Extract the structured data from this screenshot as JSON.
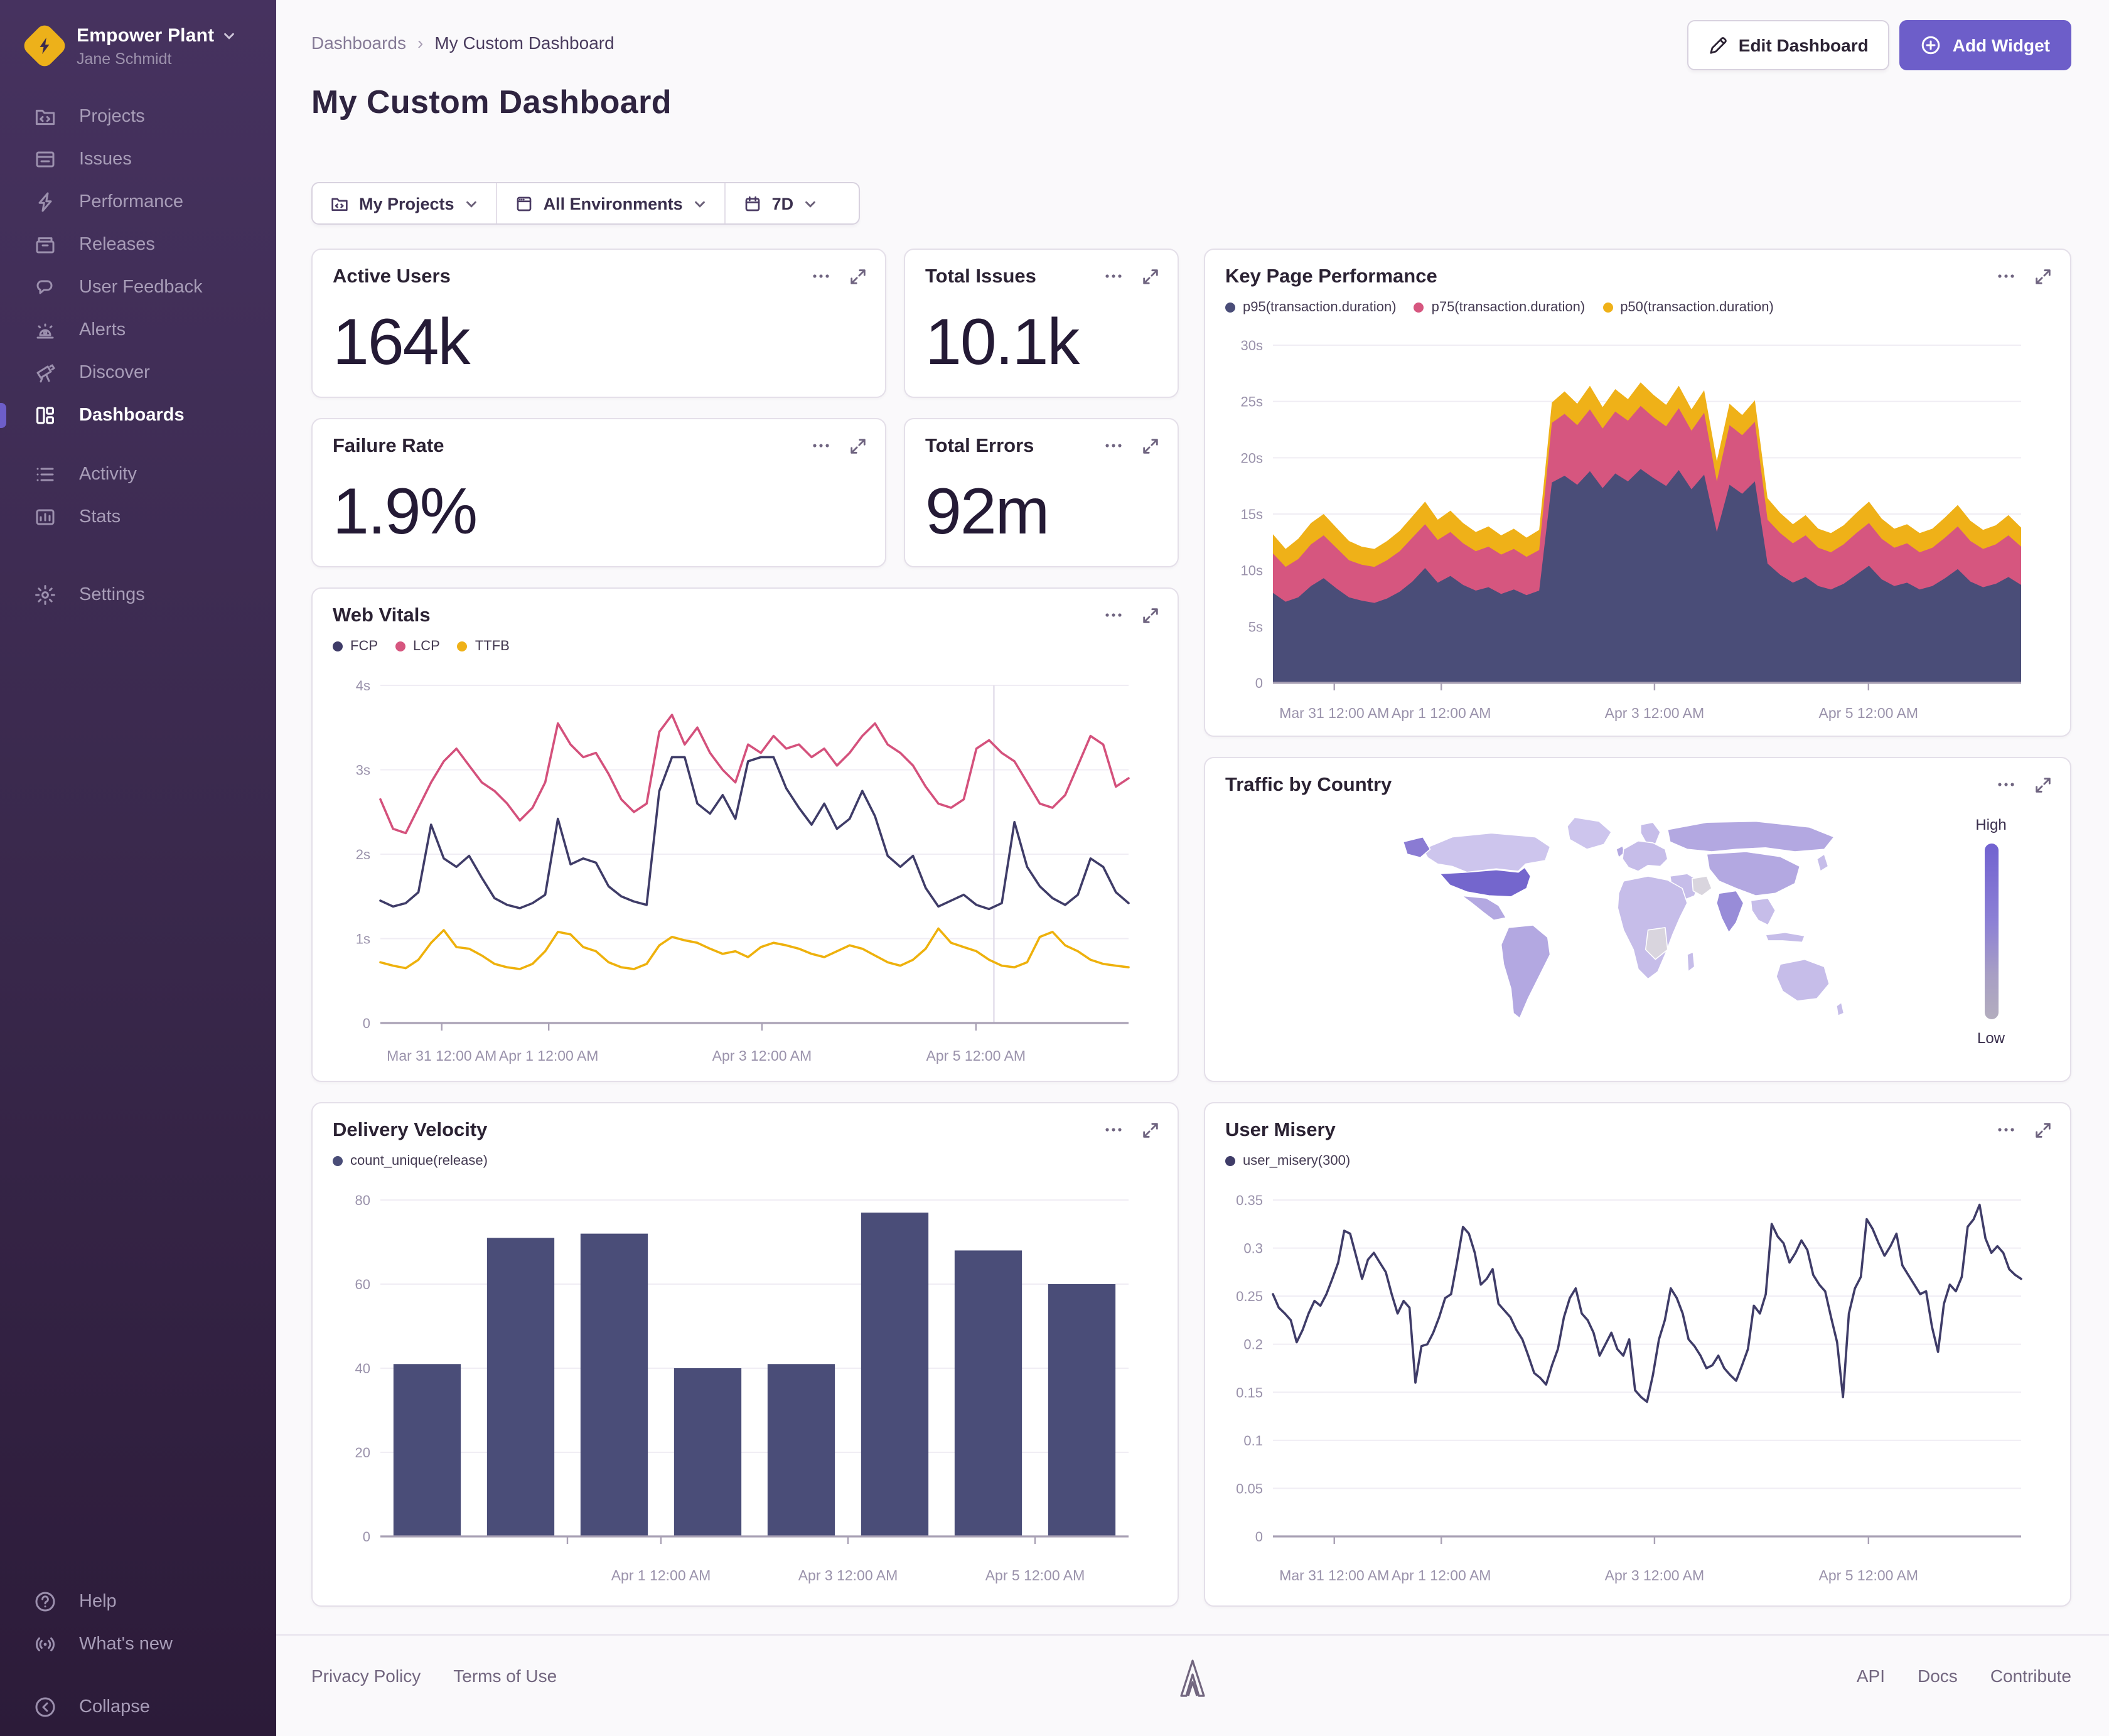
{
  "sidebar": {
    "org": "Empower Plant",
    "user": "Jane Schmidt",
    "items": [
      {
        "label": "Projects",
        "icon": "projects-icon",
        "active": false
      },
      {
        "label": "Issues",
        "icon": "issues-icon",
        "active": false
      },
      {
        "label": "Performance",
        "icon": "performance-icon",
        "active": false
      },
      {
        "label": "Releases",
        "icon": "releases-icon",
        "active": false
      },
      {
        "label": "User Feedback",
        "icon": "user-feedback-icon",
        "active": false
      },
      {
        "label": "Alerts",
        "icon": "alerts-icon",
        "active": false
      },
      {
        "label": "Discover",
        "icon": "discover-icon",
        "active": false
      },
      {
        "label": "Dashboards",
        "icon": "dashboards-icon",
        "active": true
      },
      {
        "label": "Activity",
        "icon": "activity-icon",
        "active": false
      },
      {
        "label": "Stats",
        "icon": "stats-icon",
        "active": false
      },
      {
        "label": "Settings",
        "icon": "settings-icon",
        "active": false
      }
    ],
    "bottom_items": [
      {
        "label": "Help",
        "icon": "help-icon"
      },
      {
        "label": "What's new",
        "icon": "broadcast-icon"
      },
      {
        "label": "Collapse",
        "icon": "collapse-icon"
      }
    ]
  },
  "header": {
    "breadcrumb": [
      "Dashboards",
      "My Custom Dashboard"
    ],
    "title": "My Custom Dashboard",
    "edit_label": "Edit Dashboard",
    "add_label": "Add Widget"
  },
  "filters": {
    "projects": "My Projects",
    "environments": "All Environments",
    "range": "7D"
  },
  "big_numbers": [
    {
      "title": "Active Users",
      "value": "164k"
    },
    {
      "title": "Total Issues",
      "value": "10.1k"
    },
    {
      "title": "Failure Rate",
      "value": "1.9%"
    },
    {
      "title": "Total Errors",
      "value": "92m"
    }
  ],
  "map_widget": {
    "title": "Traffic by Country",
    "legend_high": "High",
    "legend_low": "Low"
  },
  "footer": {
    "left": [
      "Privacy Policy",
      "Terms of Use"
    ],
    "right": [
      "API",
      "Docs",
      "Contribute"
    ]
  },
  "colors": {
    "accent": "#6d5ec9",
    "navy": "#4a4d78",
    "pink": "#d6567f",
    "yellow": "#efb118",
    "map_base": "#c6bde9",
    "map_light": "#cdc5ed",
    "map_mid": "#b3a8e1",
    "map_dark_us": "#7466cd",
    "map_alaska": "#8a7bd3",
    "map_india": "#988cd8",
    "map_gray": "#d9d5de"
  },
  "chart_data": [
    {
      "id": "key-page-performance",
      "type": "area",
      "title": "Key Page Performance",
      "note": "stacked totals drawn as overlapping areas (p50 top band, p75 middle, p95 base)",
      "legend": [
        {
          "label": "p95(transaction.duration)",
          "color": "#4a4d78"
        },
        {
          "label": "p75(transaction.duration)",
          "color": "#d6567f"
        },
        {
          "label": "p50(transaction.duration)",
          "color": "#efb118"
        }
      ],
      "ylim": [
        0,
        30
      ],
      "yticks": [
        {
          "v": 0,
          "label": "0"
        },
        {
          "v": 5,
          "label": "5s"
        },
        {
          "v": 10,
          "label": "10s"
        },
        {
          "v": 15,
          "label": "15s"
        },
        {
          "v": 20,
          "label": "20s"
        },
        {
          "v": 25,
          "label": "25s"
        },
        {
          "v": 30,
          "label": "30s"
        }
      ],
      "xticks": [
        {
          "pos": 0.082,
          "label": "Mar 31 12:00 AM"
        },
        {
          "pos": 0.225,
          "label": "Apr 1 12:00 AM"
        },
        {
          "pos": 0.51,
          "label": "Apr 3 12:00 AM"
        },
        {
          "pos": 0.796,
          "label": "Apr 5 12:00 AM"
        }
      ],
      "series": [
        {
          "name": "p50_total",
          "color": "#efb118",
          "fill": true,
          "values": [
            13.2,
            11.9,
            12.8,
            14.2,
            15.0,
            13.8,
            12.6,
            12.1,
            11.9,
            12.6,
            13.5,
            14.8,
            16.1,
            14.5,
            15.3,
            14.2,
            13.4,
            13.9,
            13.1,
            13.7,
            12.9,
            13.6,
            24.9,
            25.9,
            24.8,
            26.4,
            24.5,
            26.1,
            25.2,
            26.7,
            25.6,
            24.7,
            26.4,
            24.3,
            26.0,
            19.7,
            24.8,
            23.8,
            25.1,
            16.4,
            15.1,
            14.1,
            14.9,
            13.7,
            13.3,
            14.0,
            15.1,
            16.1,
            14.6,
            13.7,
            14.1,
            13.3,
            13.7,
            14.7,
            15.8,
            14.4,
            13.6,
            14.0,
            14.9,
            13.8
          ]
        },
        {
          "name": "p75_total",
          "color": "#d6567f",
          "fill": true,
          "values": [
            11.5,
            10.3,
            11.0,
            12.3,
            13.1,
            12.0,
            10.9,
            10.5,
            10.3,
            10.9,
            11.7,
            12.9,
            14.1,
            12.7,
            13.4,
            12.4,
            11.7,
            12.1,
            11.4,
            11.9,
            11.2,
            11.8,
            23.1,
            23.9,
            22.9,
            24.3,
            22.6,
            24.1,
            23.3,
            24.6,
            23.6,
            22.8,
            24.4,
            22.4,
            24.0,
            17.9,
            22.9,
            22.0,
            23.2,
            14.5,
            13.3,
            12.4,
            13.1,
            12.0,
            11.6,
            12.3,
            13.3,
            14.2,
            12.8,
            12.0,
            12.4,
            11.6,
            12.0,
            12.9,
            13.9,
            12.6,
            11.9,
            12.3,
            13.1,
            12.1
          ]
        },
        {
          "name": "p95",
          "color": "#4a4d78",
          "fill": true,
          "values": [
            8.0,
            7.2,
            7.6,
            8.6,
            9.3,
            8.4,
            7.6,
            7.3,
            7.1,
            7.5,
            8.1,
            9.0,
            10.2,
            8.9,
            9.5,
            8.7,
            8.2,
            8.5,
            7.9,
            8.3,
            7.8,
            8.2,
            17.8,
            18.4,
            17.6,
            18.8,
            17.3,
            18.6,
            17.9,
            19.0,
            18.2,
            17.5,
            18.9,
            17.2,
            18.5,
            13.4,
            17.6,
            16.8,
            17.9,
            10.6,
            9.6,
            8.9,
            9.4,
            8.6,
            8.3,
            8.8,
            9.6,
            10.4,
            9.2,
            8.6,
            8.9,
            8.3,
            8.6,
            9.3,
            10.1,
            9.0,
            8.5,
            8.8,
            9.4,
            8.7
          ]
        }
      ]
    },
    {
      "id": "web-vitals",
      "type": "line",
      "title": "Web Vitals",
      "legend": [
        {
          "label": "FCP",
          "color": "#3f3c68"
        },
        {
          "label": "LCP",
          "color": "#d6567f"
        },
        {
          "label": "TTFB",
          "color": "#efb118"
        }
      ],
      "ylim": [
        0,
        4
      ],
      "yticks": [
        {
          "v": 0,
          "label": "0"
        },
        {
          "v": 1,
          "label": "1s"
        },
        {
          "v": 2,
          "label": "2s"
        },
        {
          "v": 3,
          "label": "3s"
        },
        {
          "v": 4,
          "label": "4s"
        }
      ],
      "xticks": [
        {
          "pos": 0.082,
          "label": "Mar 31 12:00 AM"
        },
        {
          "pos": 0.225,
          "label": "Apr 1 12:00 AM"
        },
        {
          "pos": 0.51,
          "label": "Apr 3 12:00 AM"
        },
        {
          "pos": 0.796,
          "label": "Apr 5 12:00 AM"
        }
      ],
      "crosshair": 0.82,
      "series": [
        {
          "name": "LCP",
          "color": "#d4517c",
          "values": [
            2.65,
            2.3,
            2.25,
            2.55,
            2.85,
            3.1,
            3.25,
            3.05,
            2.85,
            2.75,
            2.6,
            2.4,
            2.55,
            2.85,
            3.55,
            3.3,
            3.15,
            3.2,
            2.95,
            2.65,
            2.5,
            2.6,
            3.45,
            3.65,
            3.3,
            3.5,
            3.2,
            3.0,
            2.85,
            3.3,
            3.2,
            3.4,
            3.25,
            3.3,
            3.15,
            3.25,
            3.05,
            3.2,
            3.4,
            3.55,
            3.3,
            3.2,
            3.05,
            2.8,
            2.6,
            2.55,
            2.65,
            3.25,
            3.35,
            3.2,
            3.1,
            2.85,
            2.6,
            2.55,
            2.7,
            3.05,
            3.4,
            3.3,
            2.8,
            2.9
          ]
        },
        {
          "name": "TTFB",
          "color": "#eeb10c",
          "values": [
            0.72,
            0.68,
            0.65,
            0.75,
            0.95,
            1.1,
            0.9,
            0.88,
            0.8,
            0.7,
            0.66,
            0.64,
            0.7,
            0.85,
            1.08,
            1.05,
            0.9,
            0.85,
            0.72,
            0.66,
            0.64,
            0.7,
            0.92,
            1.02,
            0.98,
            0.95,
            0.88,
            0.82,
            0.85,
            0.78,
            0.9,
            0.95,
            0.92,
            0.88,
            0.82,
            0.78,
            0.85,
            0.92,
            0.88,
            0.8,
            0.72,
            0.68,
            0.75,
            0.88,
            1.12,
            0.95,
            0.9,
            0.85,
            0.75,
            0.68,
            0.66,
            0.72,
            1.02,
            1.08,
            0.92,
            0.85,
            0.75,
            0.7,
            0.68,
            0.66
          ]
        },
        {
          "name": "FCP",
          "color": "#3f3c68",
          "values": [
            1.45,
            1.38,
            1.42,
            1.55,
            2.35,
            1.95,
            1.85,
            1.98,
            1.72,
            1.48,
            1.4,
            1.36,
            1.42,
            1.52,
            2.42,
            1.88,
            1.95,
            1.9,
            1.62,
            1.5,
            1.44,
            1.4,
            2.75,
            3.15,
            3.15,
            2.6,
            2.48,
            2.7,
            2.42,
            3.1,
            3.15,
            3.15,
            2.78,
            2.55,
            2.35,
            2.6,
            2.3,
            2.42,
            2.75,
            2.45,
            1.98,
            1.85,
            1.98,
            1.6,
            1.38,
            1.45,
            1.52,
            1.4,
            1.35,
            1.42,
            2.38,
            1.85,
            1.62,
            1.48,
            1.4,
            1.52,
            1.95,
            1.85,
            1.55,
            1.42
          ]
        }
      ]
    },
    {
      "id": "delivery-velocity",
      "type": "bar",
      "title": "Delivery Velocity",
      "legend": [
        {
          "label": "count_unique(release)",
          "color": "#4a4d78"
        }
      ],
      "ylim": [
        0,
        80
      ],
      "yticks": [
        {
          "v": 0,
          "label": "0"
        },
        {
          "v": 20,
          "label": "20"
        },
        {
          "v": 40,
          "label": "40"
        },
        {
          "v": 60,
          "label": "60"
        },
        {
          "v": 80,
          "label": "80"
        }
      ],
      "xticks": [
        {
          "pos": 0.25,
          "label": ""
        },
        {
          "pos": 0.375,
          "label": "Apr 1 12:00 AM"
        },
        {
          "pos": 0.625,
          "label": "Apr 3 12:00 AM"
        },
        {
          "pos": 0.875,
          "label": "Apr 5 12:00 AM"
        }
      ],
      "bar_color": "#4a4d78",
      "values": [
        41,
        71,
        72,
        40,
        41,
        77,
        68,
        60
      ]
    },
    {
      "id": "user-misery",
      "type": "line",
      "title": "User Misery",
      "legend": [
        {
          "label": "user_misery(300)",
          "color": "#3f3c68"
        }
      ],
      "ylim": [
        0,
        0.35
      ],
      "yticks": [
        {
          "v": 0,
          "label": "0"
        },
        {
          "v": 0.05,
          "label": "0.05"
        },
        {
          "v": 0.1,
          "label": "0.1"
        },
        {
          "v": 0.15,
          "label": "0.15"
        },
        {
          "v": 0.2,
          "label": "0.2"
        },
        {
          "v": 0.25,
          "label": "0.25"
        },
        {
          "v": 0.3,
          "label": "0.3"
        },
        {
          "v": 0.35,
          "label": "0.35"
        }
      ],
      "xticks": [
        {
          "pos": 0.082,
          "label": "Mar 31 12:00 AM"
        },
        {
          "pos": 0.225,
          "label": "Apr 1 12:00 AM"
        },
        {
          "pos": 0.51,
          "label": "Apr 3 12:00 AM"
        },
        {
          "pos": 0.796,
          "label": "Apr 5 12:00 AM"
        }
      ],
      "series": [
        {
          "name": "user_misery(300)",
          "color": "#3f3c68",
          "values": [
            0.252,
            0.238,
            0.232,
            0.225,
            0.202,
            0.215,
            0.232,
            0.245,
            0.24,
            0.252,
            0.268,
            0.285,
            0.318,
            0.315,
            0.292,
            0.268,
            0.288,
            0.295,
            0.285,
            0.275,
            0.252,
            0.232,
            0.245,
            0.238,
            0.16,
            0.198,
            0.2,
            0.212,
            0.228,
            0.248,
            0.252,
            0.285,
            0.322,
            0.315,
            0.295,
            0.262,
            0.268,
            0.278,
            0.242,
            0.235,
            0.228,
            0.215,
            0.205,
            0.188,
            0.17,
            0.165,
            0.158,
            0.178,
            0.195,
            0.228,
            0.248,
            0.258,
            0.232,
            0.225,
            0.212,
            0.188,
            0.2,
            0.212,
            0.195,
            0.188,
            0.205,
            0.152,
            0.145,
            0.14,
            0.168,
            0.205,
            0.225,
            0.258,
            0.248,
            0.232,
            0.205,
            0.198,
            0.188,
            0.175,
            0.178,
            0.188,
            0.175,
            0.168,
            0.162,
            0.178,
            0.195,
            0.24,
            0.232,
            0.252,
            0.325,
            0.312,
            0.305,
            0.285,
            0.295,
            0.308,
            0.298,
            0.272,
            0.262,
            0.255,
            0.228,
            0.202,
            0.145,
            0.232,
            0.258,
            0.27,
            0.33,
            0.32,
            0.305,
            0.292,
            0.302,
            0.315,
            0.282,
            0.272,
            0.262,
            0.252,
            0.255,
            0.218,
            0.192,
            0.242,
            0.262,
            0.255,
            0.27,
            0.322,
            0.33,
            0.345,
            0.31,
            0.295,
            0.302,
            0.295,
            0.278,
            0.272,
            0.268
          ]
        }
      ]
    }
  ]
}
